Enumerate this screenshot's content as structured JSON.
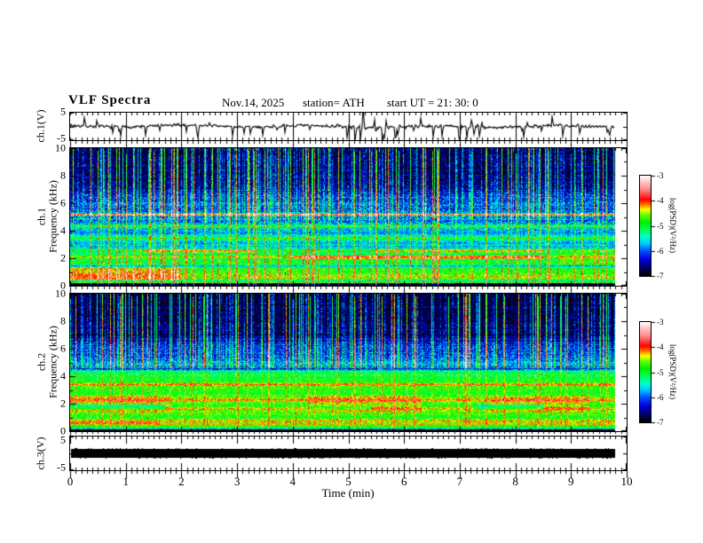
{
  "header": {
    "title": "VLF Spectra",
    "date": "Nov.14, 2025",
    "station": "station= ATH",
    "start_ut": "start UT =  21: 30: 0"
  },
  "x_axis": {
    "label": "Time  (min)",
    "min": 0,
    "max": 10,
    "major_ticks": [
      0,
      1,
      2,
      3,
      4,
      5,
      6,
      7,
      8,
      9,
      10
    ],
    "minor_step": 0.1,
    "data_end_min": 9.78
  },
  "colorbar": {
    "label": "log(PSD)(V²/Hz)",
    "min": -7,
    "max": -3,
    "ticks": [
      -3,
      -4,
      -5,
      -6,
      -7
    ],
    "stops": [
      [
        -7,
        "#000000"
      ],
      [
        -6.7,
        "#000066"
      ],
      [
        -6.35,
        "#0000dd"
      ],
      [
        -6.0,
        "#0055ff"
      ],
      [
        -5.7,
        "#00ccff"
      ],
      [
        -5.45,
        "#00ffcc"
      ],
      [
        -5.15,
        "#00ff55"
      ],
      [
        -4.85,
        "#00ee00"
      ],
      [
        -4.55,
        "#66ff00"
      ],
      [
        -4.35,
        "#ffff00"
      ],
      [
        -4.15,
        "#ff7700"
      ],
      [
        -3.95,
        "#ff0000"
      ],
      [
        -3.55,
        "#ff8888"
      ],
      [
        -3.2,
        "#ffcccc"
      ],
      [
        -3.0,
        "#ffffff"
      ]
    ]
  },
  "chart_data": [
    {
      "type": "line",
      "panel": "ch1-waveform",
      "ylabel": "ch.1(V)",
      "ylim": [
        -5,
        5
      ],
      "yticks": [
        5,
        -5
      ],
      "baseline_v": 0,
      "noise_v": 0.7,
      "spike_count": 60,
      "spike_v_max": 4.2,
      "seed": 7,
      "trace_color": "#000000"
    },
    {
      "type": "heatmap",
      "panel": "ch1-spectrogram",
      "ylabel_line1": "ch.1",
      "ylabel_line2": "Frequency  (kHz)",
      "ylim": [
        0,
        10
      ],
      "yticks": [
        10,
        8,
        6,
        4,
        2,
        0
      ],
      "seed": 11,
      "noise": 0.6,
      "profile": [
        [
          10,
          -6.8
        ],
        [
          8.5,
          -6.85
        ],
        [
          7.2,
          -6.7
        ],
        [
          6.5,
          -6.25
        ],
        [
          5.5,
          -6.1
        ],
        [
          4.6,
          -5.95
        ],
        [
          3.8,
          -5.8
        ],
        [
          3.0,
          -5.75
        ],
        [
          2.3,
          -5.5
        ],
        [
          1.5,
          -5.35
        ],
        [
          1.0,
          -5.2
        ],
        [
          0.6,
          -5.05
        ],
        [
          0.45,
          -5.4
        ],
        [
          0.3,
          -6.6
        ],
        [
          0.12,
          -7.3
        ],
        [
          0,
          -7.3
        ]
      ],
      "bands": [
        [
          5.2,
          0.05,
          2.4
        ],
        [
          4.35,
          0.1,
          0.8
        ],
        [
          3.5,
          0.12,
          0.7
        ],
        [
          2.55,
          0.1,
          0.6
        ],
        [
          2.1,
          0.12,
          0.8
        ],
        [
          1.75,
          0.08,
          0.5
        ],
        [
          1.45,
          0.04,
          -0.6
        ],
        [
          1.2,
          0.1,
          0.5
        ],
        [
          0.85,
          0.12,
          0.5
        ],
        [
          0.55,
          0.1,
          0.5
        ],
        [
          0.28,
          0.05,
          2.0
        ]
      ],
      "patches": [
        [
          0,
          2,
          0.4,
          1.4,
          0.55
        ],
        [
          1.3,
          3.3,
          2.45,
          2.65,
          0.6
        ],
        [
          5.5,
          8.5,
          2.45,
          2.65,
          0.55
        ],
        [
          4.0,
          8.5,
          2.0,
          2.2,
          0.55
        ],
        [
          8.8,
          9.8,
          1.5,
          2.7,
          0.3
        ]
      ],
      "streaks": {
        "strong_prob": 0.17,
        "mild_prob": 0.4,
        "fmin": 4.8,
        "low_mask": 0.3
      }
    },
    {
      "type": "heatmap",
      "panel": "ch2-spectrogram",
      "ylabel_line1": "ch.2",
      "ylabel_line2": "Frequency  (kHz)",
      "ylim": [
        0,
        10
      ],
      "yticks": [
        10,
        8,
        6,
        4,
        2,
        0
      ],
      "seed": 23,
      "noise": 0.55,
      "profile": [
        [
          10,
          -6.9
        ],
        [
          8.7,
          -6.95
        ],
        [
          7.0,
          -6.8
        ],
        [
          6.3,
          -6.35
        ],
        [
          5.4,
          -6.15
        ],
        [
          4.8,
          -5.8
        ],
        [
          4.4,
          -5.3
        ],
        [
          4.0,
          -4.95
        ],
        [
          3.6,
          -4.9
        ],
        [
          3.42,
          -4.2
        ],
        [
          3.25,
          -4.85
        ],
        [
          2.8,
          -4.85
        ],
        [
          2.4,
          -4.55
        ],
        [
          2.0,
          -4.7
        ],
        [
          1.7,
          -4.5
        ],
        [
          1.35,
          -4.75
        ],
        [
          1.0,
          -4.85
        ],
        [
          0.78,
          -4.2
        ],
        [
          0.6,
          -4.5
        ],
        [
          0.5,
          -4.35
        ],
        [
          0.35,
          -4.7
        ],
        [
          0.22,
          -5.3
        ],
        [
          0.12,
          -7.3
        ],
        [
          0,
          -7.3
        ]
      ],
      "bands": [
        [
          4.7,
          0.03,
          -0.7
        ],
        [
          4.55,
          0.04,
          -0.9
        ],
        [
          2.3,
          0.05,
          0.35
        ],
        [
          1.9,
          0.04,
          -0.45
        ],
        [
          1.65,
          0.05,
          0.3
        ],
        [
          0.45,
          0.03,
          -0.5
        ]
      ],
      "patches": [
        [
          0,
          1.8,
          1.4,
          2.6,
          0.3
        ],
        [
          4.3,
          6.3,
          1.4,
          2.6,
          0.3
        ],
        [
          7.5,
          9.3,
          1.4,
          2.6,
          0.3
        ],
        [
          0,
          1.7,
          1.55,
          1.95,
          -0.8
        ],
        [
          4.3,
          5.4,
          1.6,
          1.85,
          -0.6
        ],
        [
          7.3,
          8.5,
          1.55,
          1.95,
          -0.7
        ],
        [
          0,
          1.6,
          0.55,
          0.75,
          0.3
        ]
      ],
      "streaks": {
        "strong_prob": 0.15,
        "mild_prob": 0.38,
        "fmin": 4.6,
        "low_mask": 0.12
      }
    },
    {
      "type": "line",
      "panel": "ch3-waveform",
      "ylabel": "ch.3(V)",
      "ylim": [
        -5,
        5
      ],
      "yticks": [
        5,
        -5
      ],
      "flat_v": 0,
      "line_thickness_v": 1.3,
      "seed": 3,
      "trace_color": "#000000"
    }
  ]
}
